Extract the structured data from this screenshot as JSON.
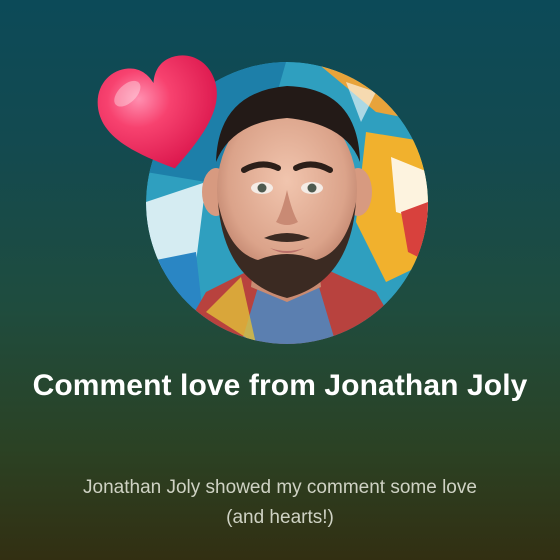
{
  "card": {
    "title": "Comment love from Jonathan Joly",
    "description": "Jonathan Joly showed my comment some love (and hearts!)"
  },
  "icons": {
    "heart": "heart-icon",
    "avatar": "avatar"
  },
  "colors": {
    "heart": "#f0356a",
    "title_text": "#ffffff",
    "description_text": "#cfd2c4",
    "background_top": "#0c4a58",
    "background_bottom": "#322f12"
  }
}
